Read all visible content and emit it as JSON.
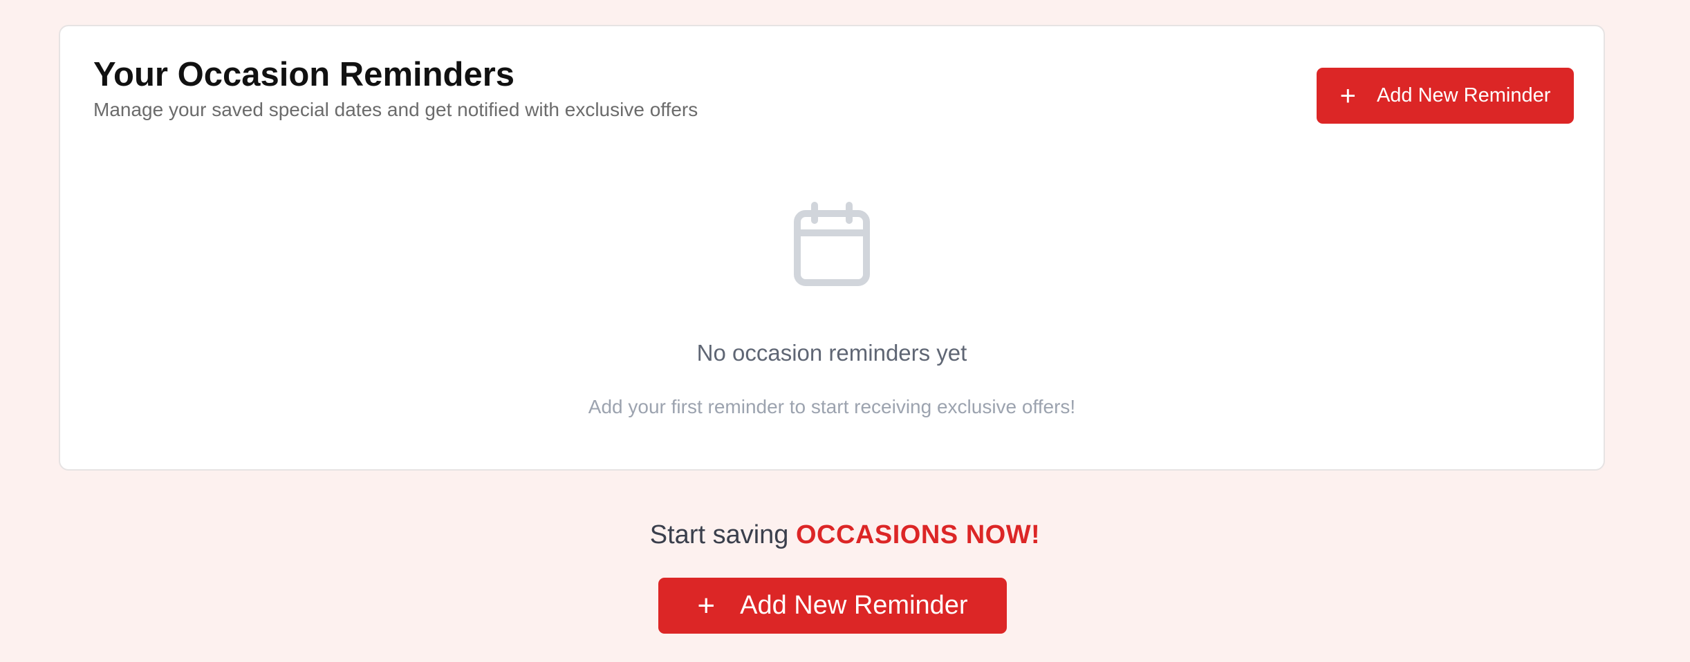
{
  "header": {
    "title": "Your Occasion Reminders",
    "subtitle": "Manage your saved special dates and get notified with exclusive offers",
    "add_button": {
      "icon": "plus-icon",
      "label": "Add New Reminder"
    }
  },
  "empty_state": {
    "icon": "calendar-icon",
    "title": "No occasion reminders yet",
    "description": "Add your first reminder to start receiving exclusive offers!"
  },
  "cta": {
    "prefix": "Start saving",
    "highlight": "OCCASIONS NOW!",
    "button": {
      "icon": "plus-icon",
      "label": "Add New Reminder"
    }
  },
  "colors": {
    "accent": "#dc2626",
    "background": "#fdf1ef",
    "card": "#ffffff",
    "icon_muted": "#d1d5db"
  }
}
